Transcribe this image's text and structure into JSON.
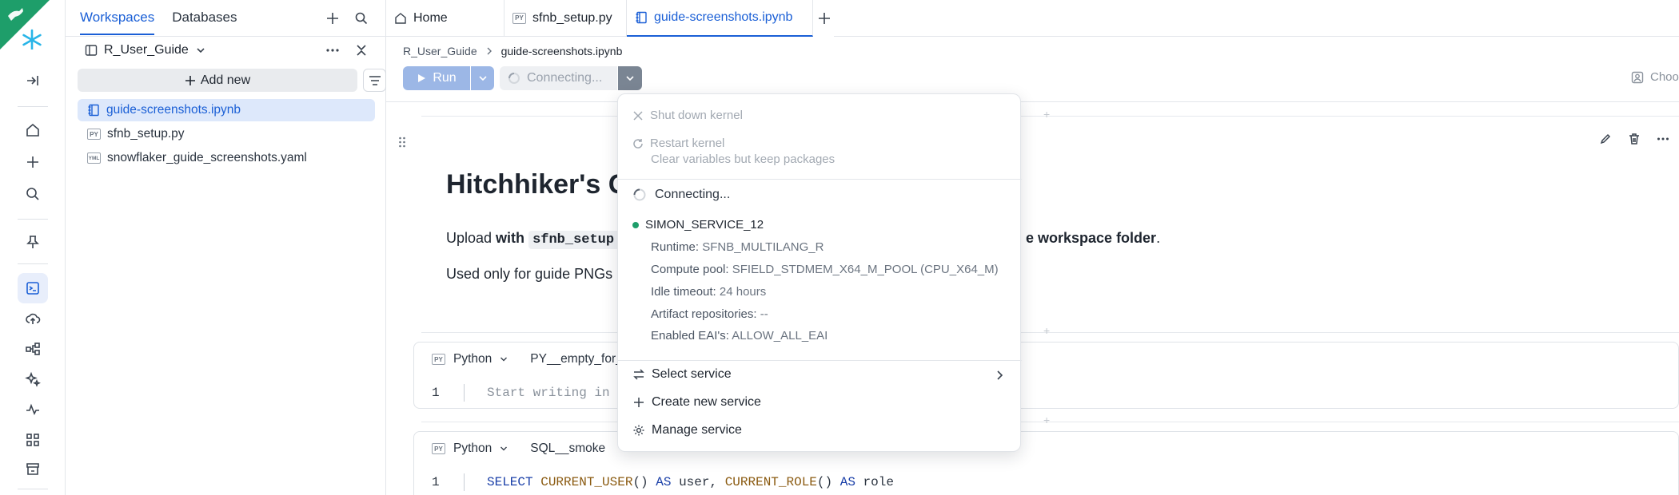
{
  "files_panel": {
    "tabs": [
      "Workspaces",
      "Databases"
    ],
    "workspace_name": "R_User_Guide",
    "add_new_label": "Add new",
    "files": [
      {
        "type": "notebook",
        "name": "guide-screenshots.ipynb"
      },
      {
        "type": "PY",
        "name": "sfnb_setup.py"
      },
      {
        "type": "YML",
        "name": "snowflaker_guide_screenshots.yaml"
      }
    ]
  },
  "editor_tabs": [
    "Home",
    "sfnb_setup.py",
    "guide-screenshots.ipynb"
  ],
  "breadcrumb": [
    "R_User_Guide",
    "guide-screenshots.ipynb"
  ],
  "toolbar": {
    "run_label": "Run",
    "connecting_label": "Connecting...",
    "choose_label": "Choo"
  },
  "notebook": {
    "heading": "Hitchhiker's G",
    "para1": {
      "pre": "Upload ",
      "bold": "with",
      "code": "sfnb_setup.",
      "post_bold": "e workspace folder",
      "tail": "."
    },
    "para2": "Used only for guide PNGs",
    "cells": [
      {
        "lang": "Python",
        "name": "PY__empty_for_e",
        "line_no": "1",
        "code": "Start writing in Py"
      },
      {
        "lang": "Python",
        "name": "SQL__smoke",
        "line_no": "1",
        "code": {
          "kw1": "SELECT",
          "fn1": "CURRENT_USER",
          "p1": "()",
          "kw2": "AS",
          "id1": "user,",
          "fn2": "CURRENT_ROLE",
          "p2": "()",
          "kw3": "AS",
          "id2": "role"
        }
      }
    ]
  },
  "kernel_menu": {
    "shutdown": "Shut down kernel",
    "restart": "Restart kernel",
    "restart_sub": "Clear variables but keep packages",
    "status": "Connecting...",
    "service_name": "SIMON_SERVICE_12",
    "status_color": "#1e9e6a",
    "details": [
      {
        "key": "Runtime:",
        "value": "SFNB_MULTILANG_R"
      },
      {
        "key": "Compute pool:",
        "value": "SFIELD_STDMEM_X64_M_POOL (CPU_X64_M)"
      },
      {
        "key": "Idle timeout:",
        "value": "24 hours"
      },
      {
        "key": "Artifact repositories:",
        "value": "--"
      },
      {
        "key": "Enabled EAI's:",
        "value": "ALLOW_ALL_EAI"
      }
    ],
    "select_service": "Select service",
    "create_service": "Create new service",
    "manage_service": "Manage service"
  },
  "colors": {
    "accent": "#1a5fd6",
    "brand": "#29b5e8",
    "corner": "#1e9e6a"
  }
}
